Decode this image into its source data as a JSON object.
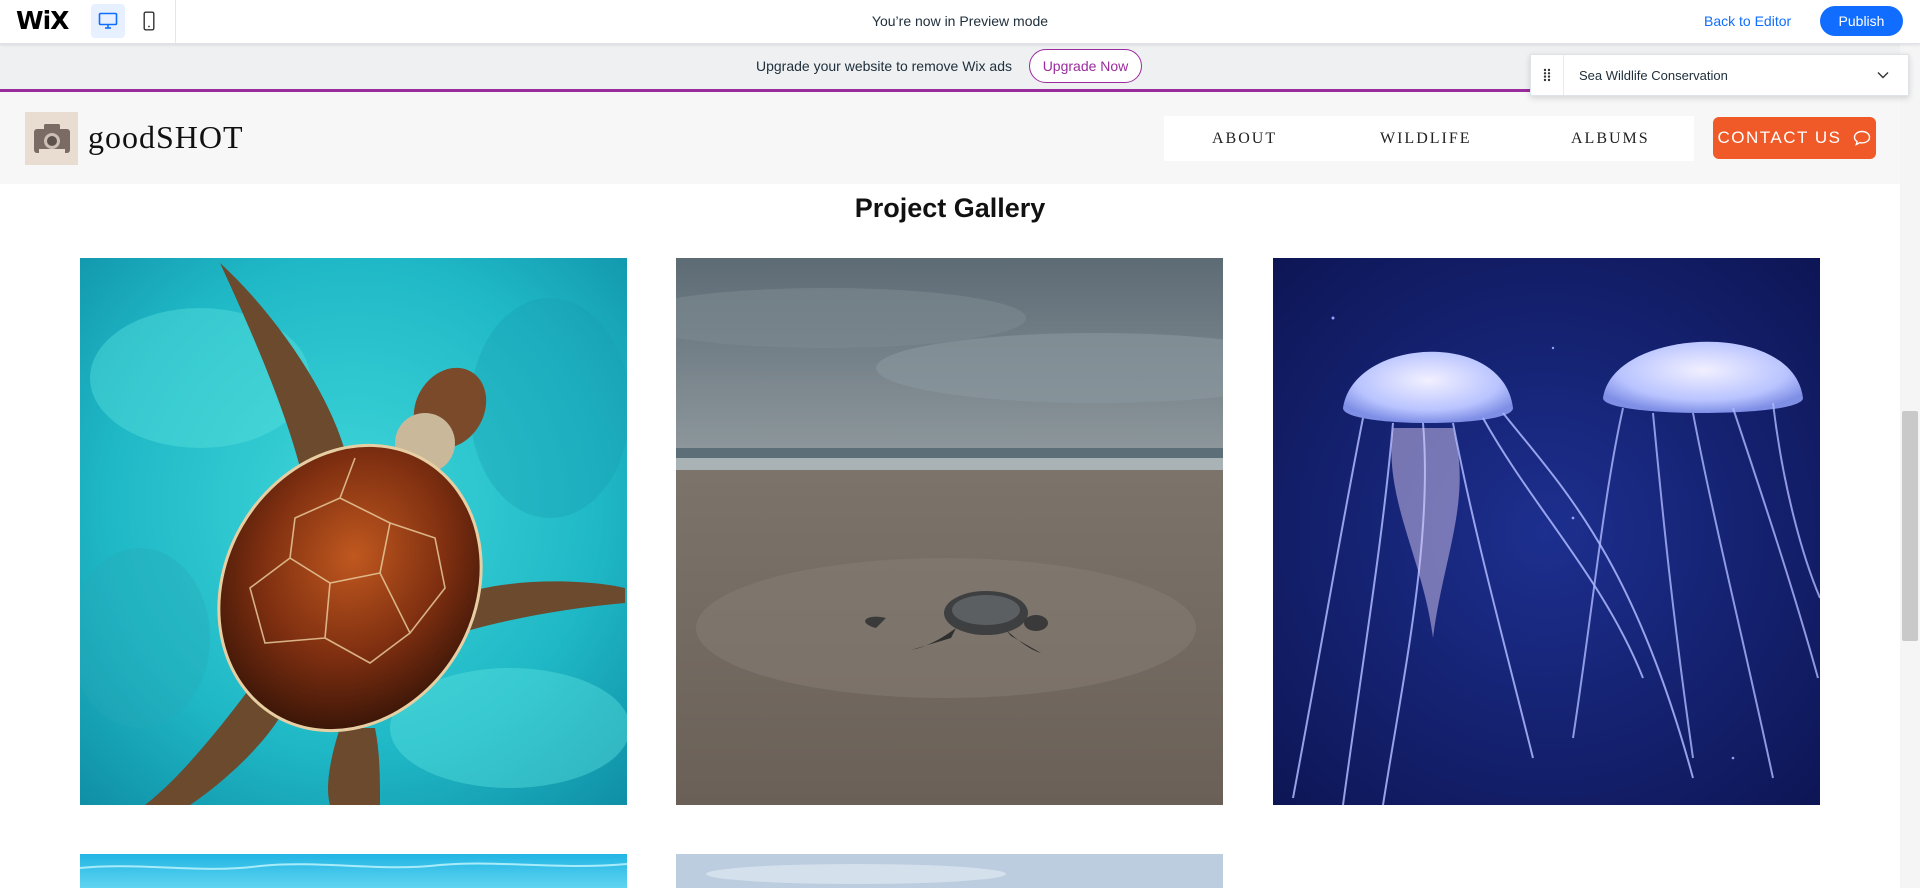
{
  "wix_bar": {
    "logo": "WiX",
    "preview_message": "You’re now in Preview mode",
    "back_to_editor": "Back to Editor",
    "publish": "Publish",
    "accent_color": "#116dff"
  },
  "upgrade_banner": {
    "message": "Upgrade your website to remove Wix ads",
    "button": "Upgrade Now",
    "accent_color": "#9a2b9c"
  },
  "page_selector": {
    "selected": "Sea Wildlife Conservation"
  },
  "site_header": {
    "site_name": "goodSHOT",
    "nav": [
      "ABOUT",
      "WILDLIFE",
      "ALBUMS"
    ],
    "contact_button": "CONTACT US",
    "contact_color": "#f05a28"
  },
  "gallery": {
    "title": "Project Gallery",
    "items": [
      "sea turtle swimming",
      "baby turtle on beach",
      "jellyfish",
      "ocean water",
      "sky"
    ]
  }
}
